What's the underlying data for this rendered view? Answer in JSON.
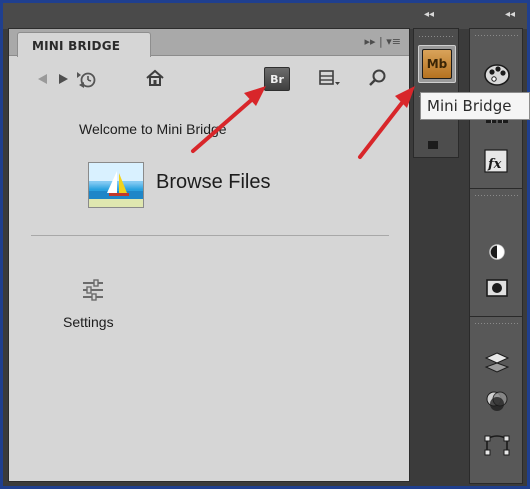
{
  "panel": {
    "tab_label": "MINI BRIDGE",
    "menu_glyph": "▸▸ | ▾≡",
    "welcome_text": "Welcome to Mini Bridge",
    "browse_label": "Browse Files",
    "settings_label": "Settings",
    "br_label": "Br"
  },
  "dock": {
    "collapse_glyph": "◂◂",
    "mb_label": "Mb",
    "tooltip": "Mini Bridge"
  },
  "icons": {
    "back": "back-arrow-icon",
    "forward": "forward-arrow-icon",
    "recent": "recent-history-icon",
    "home": "home-icon",
    "view": "view-options-icon",
    "search": "search-icon",
    "settings": "sliders-icon"
  },
  "colors": {
    "frame_border": "#1f3f8f",
    "arrow_red": "#d8262a",
    "mb_orange": "#c7832c"
  }
}
